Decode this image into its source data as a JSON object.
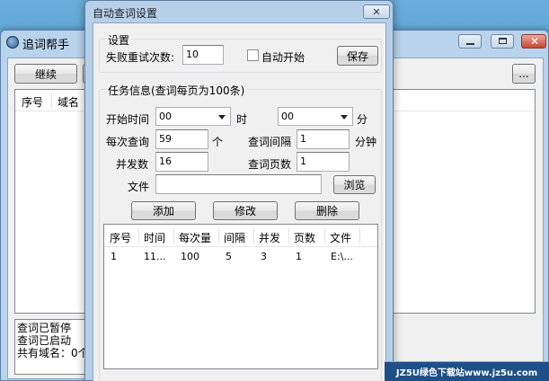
{
  "bg_window": {
    "title": "追词帮手",
    "continue_label": "继续",
    "more_label": "...",
    "headers": [
      "序号",
      "域名"
    ],
    "log_lines": [
      "查词已暂停",
      "查词已启动",
      "共有域名：0个"
    ]
  },
  "dialog": {
    "title": "自动查词设置",
    "close_glyph": "✕",
    "settings": {
      "group_title": "设置",
      "retry_label": "失败重试次数:",
      "retry_value": "10",
      "autostart_label": "自动开始",
      "save_label": "保存"
    },
    "task": {
      "group_title": "任务信息(查词每页为100条)",
      "start_time_label": "开始时间",
      "hour_value": "00",
      "hour_unit": "时",
      "minute_value": "00",
      "minute_unit": "分",
      "per_query_label": "每次查询",
      "per_query_value": "59",
      "per_query_unit": "个",
      "interval_label": "查词间隔",
      "interval_value": "1",
      "interval_unit": "分钟",
      "concurrency_label": "并发数",
      "concurrency_value": "16",
      "pages_label": "查词页数",
      "pages_value": "1",
      "file_label": "文件",
      "file_value": "",
      "browse_label": "浏览",
      "add_label": "添加",
      "edit_label": "修改",
      "delete_label": "删除"
    },
    "table": {
      "headers": [
        "序号",
        "时间",
        "每次量",
        "间隔",
        "并发",
        "页数",
        "文件"
      ],
      "rows": [
        [
          "1",
          "11...",
          "100",
          "5",
          "3",
          "1",
          "E:\\..."
        ]
      ]
    }
  },
  "watermark": "JZ5U绿色下载站www.jz5u.com",
  "colors": {
    "desktop": "#3d8fc8",
    "frame": "#b9d3ec",
    "dialog_body": "#f0f0f0"
  }
}
